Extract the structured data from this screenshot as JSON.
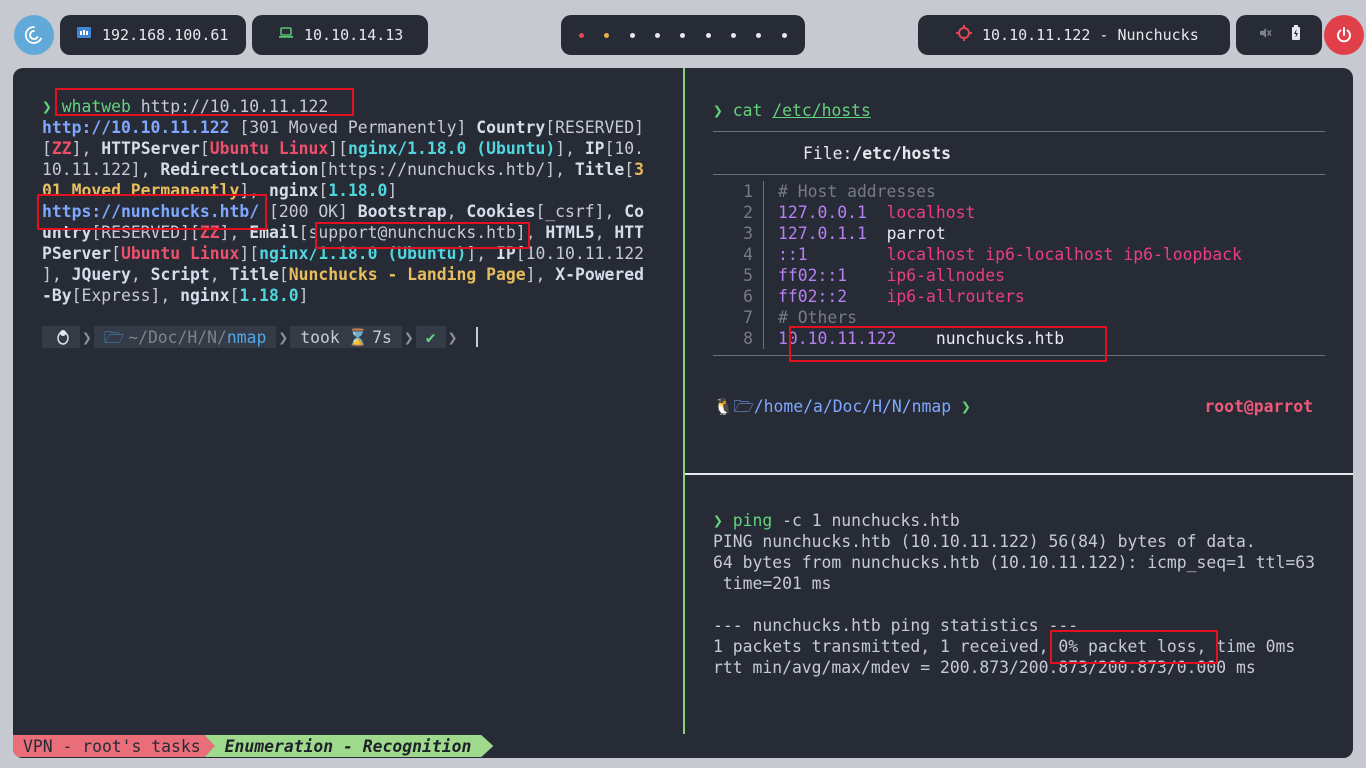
{
  "topbar": {
    "logo_icon": "debian-swirl-icon",
    "ip1": "192.168.100.61",
    "ip2": "10.10.14.13",
    "target": "10.10.11.122 - Nunchucks"
  },
  "left_pane": {
    "cmd_prompt": "❯",
    "cmd_name": "whatweb",
    "cmd_arg": " http://10.10.11.122",
    "out_lines": [
      [
        [
          "url",
          "http://10.10.11.122"
        ],
        [
          "gr",
          " [301 Moved Permanently] "
        ],
        [
          "key",
          "Country"
        ],
        [
          "gr",
          "[RESERVED]"
        ]
      ],
      [
        [
          "gr",
          "["
        ],
        [
          "red",
          "ZZ"
        ],
        [
          "gr",
          "], "
        ],
        [
          "key",
          "HTTPServer"
        ],
        [
          "gr",
          "["
        ],
        [
          "red",
          "Ubuntu Linux"
        ],
        [
          "gr",
          "]["
        ],
        [
          "cyan",
          "nginx/1.18.0 (Ubuntu)"
        ],
        [
          "gr",
          "], "
        ],
        [
          "key",
          "IP"
        ],
        [
          "gr",
          "[10."
        ]
      ],
      [
        [
          "gr",
          "10.11.122], "
        ],
        [
          "key",
          "RedirectLocation"
        ],
        [
          "gr",
          "[https://nunchucks.htb/], "
        ],
        [
          "key",
          "Title"
        ],
        [
          "gr",
          "["
        ],
        [
          "yel",
          "3"
        ]
      ],
      [
        [
          "yel",
          "01 Moved Permanently"
        ],
        [
          "gr",
          "], "
        ],
        [
          "key",
          "nginx"
        ],
        [
          "gr",
          "["
        ],
        [
          "cyan",
          "1.18.0"
        ],
        [
          "gr",
          "]"
        ]
      ],
      [
        [
          "url",
          "https://nunchucks.htb/"
        ],
        [
          "gr",
          " [200 OK] "
        ],
        [
          "key",
          "Bootstrap"
        ],
        [
          "gr",
          ", "
        ],
        [
          "key",
          "Cookies"
        ],
        [
          "gr",
          "[_csrf], "
        ],
        [
          "key",
          "Co"
        ]
      ],
      [
        [
          "key",
          "untry"
        ],
        [
          "gr",
          "[RESERVED]["
        ],
        [
          "red",
          "ZZ"
        ],
        [
          "gr",
          "], "
        ],
        [
          "key",
          "Email"
        ],
        [
          "gr",
          "[support@nunchucks.htb], "
        ],
        [
          "key",
          "HTML5"
        ],
        [
          "gr",
          ", "
        ],
        [
          "key",
          "HTT"
        ]
      ],
      [
        [
          "key",
          "PServer"
        ],
        [
          "gr",
          "["
        ],
        [
          "red",
          "Ubuntu Linux"
        ],
        [
          "gr",
          "]["
        ],
        [
          "cyan",
          "nginx/1.18.0 (Ubuntu)"
        ],
        [
          "gr",
          "], "
        ],
        [
          "key",
          "IP"
        ],
        [
          "gr",
          "[10.10.11.122"
        ]
      ],
      [
        [
          "gr",
          "], "
        ],
        [
          "key",
          "JQuery"
        ],
        [
          "gr",
          ", "
        ],
        [
          "key",
          "Script"
        ],
        [
          "gr",
          ", "
        ],
        [
          "key",
          "Title"
        ],
        [
          "gr",
          "["
        ],
        [
          "yel",
          "Nunchucks - Landing Page"
        ],
        [
          "gr",
          "], "
        ],
        [
          "key",
          "X-Powered"
        ]
      ],
      [
        [
          "key",
          "-By"
        ],
        [
          "gr",
          "[Express], "
        ],
        [
          "key",
          "nginx"
        ],
        [
          "gr",
          "["
        ],
        [
          "cyan",
          "1.18.0"
        ],
        [
          "gr",
          "]"
        ]
      ]
    ],
    "prompt_path_prefix": "~/Doc/H/N/",
    "prompt_path_dir": "nmap",
    "prompt_took": "took",
    "prompt_time": "7s",
    "prompt_check": "✔"
  },
  "right_top": {
    "cmd_prompt": "❯",
    "cmd_name": "cat",
    "cmd_arg": "/etc/hosts",
    "file_label": "File: ",
    "file_name": "/etc/hosts",
    "rows": [
      {
        "n": "1",
        "a": "# Host addresses",
        "b": "",
        "ca": "cmt",
        "cb": "wht"
      },
      {
        "n": "2",
        "a": "127.0.0.1  ",
        "b": "localhost",
        "ca": "pur",
        "cb": "pink"
      },
      {
        "n": "3",
        "a": "127.0.1.1  ",
        "b": "parrot",
        "ca": "pur",
        "cb": "wht"
      },
      {
        "n": "4",
        "a": "::1        ",
        "b": "localhost ip6-localhost ip6-loopback",
        "ca": "pur",
        "cb": "pink"
      },
      {
        "n": "5",
        "a": "ff02::1    ",
        "b": "ip6-allnodes",
        "ca": "pur",
        "cb": "pink"
      },
      {
        "n": "6",
        "a": "ff02::2    ",
        "b": "ip6-allrouters",
        "ca": "pur",
        "cb": "pink"
      },
      {
        "n": "7",
        "a": "# Others",
        "b": "",
        "ca": "cmt",
        "cb": "wht"
      },
      {
        "n": "8",
        "a": "10.10.11.122    ",
        "b": "nunchucks.htb",
        "ca": "pur",
        "cb": "wht"
      }
    ],
    "prompt_path": "/home/a/Doc/H/N/nmap",
    "prompt_arrow": "❯",
    "user": "root@parrot"
  },
  "right_bottom": {
    "cmd_prompt": "❯",
    "cmd_name": "ping",
    "cmd_arg": " -c 1 nunchucks.htb",
    "lines": [
      "PING nunchucks.htb (10.10.11.122) 56(84) bytes of data.",
      "64 bytes from nunchucks.htb (10.10.11.122): icmp_seq=1 ttl=63",
      " time=201 ms",
      "",
      "--- nunchucks.htb ping statistics ---",
      "1 packets transmitted, 1 received, 0% packet loss, time 0ms",
      "rtt min/avg/max/mdev = 200.873/200.873/200.873/0.000 ms"
    ]
  },
  "statusbar": {
    "session": "VPN - root's tasks",
    "window": "Enumeration - Recognition"
  }
}
